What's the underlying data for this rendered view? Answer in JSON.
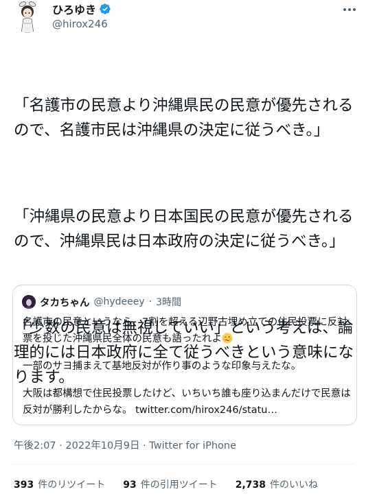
{
  "author": {
    "name": "ひろゆき",
    "handle": "@hirox246"
  },
  "tweet": {
    "paragraphs": [
      "「名護市の民意より沖縄県民の民意が優先されるので、名護市民は沖縄県の決定に従うべき。」",
      "「沖縄県の民意より日本国民の民意が優先されるので、沖縄県民は日本政府の決定に従うべき。」",
      "「少数の民意は無視していい」という考えは、論理的には日本政府に全て従うべきという意味になります。"
    ]
  },
  "quote": {
    "name": "タカちゃん",
    "handle": "@hydeeey",
    "separator": "·",
    "time": "3時間",
    "p1": "名護市の民意というなら、7割を超える辺野古埋め立ての住民投票に反対票を投じた沖縄県民全体の民意も語ったれよ",
    "p2": "一部のサヨ捕まえて基地反対が作り事のような印象与えたな。",
    "p3": "大阪は都構想で住民投票したけど、いちいち誰も座り込まんだけで民意は反対が勝利したからな。",
    "link": "twitter.com/hirox246/statu…"
  },
  "meta": {
    "timestamp": "午後2:07 · 2022年10月9日 · Twitter for iPhone"
  },
  "stats": {
    "retweets_count": "393",
    "retweets_label": "件のリツイート",
    "quotes_count": "93",
    "quotes_label": "件の引用ツイート",
    "likes_count": "2,738",
    "likes_label": "件のいいね"
  },
  "colors": {
    "verified": "#1d9bf0",
    "secondary_text": "#536471",
    "border": "#cfd9de"
  }
}
